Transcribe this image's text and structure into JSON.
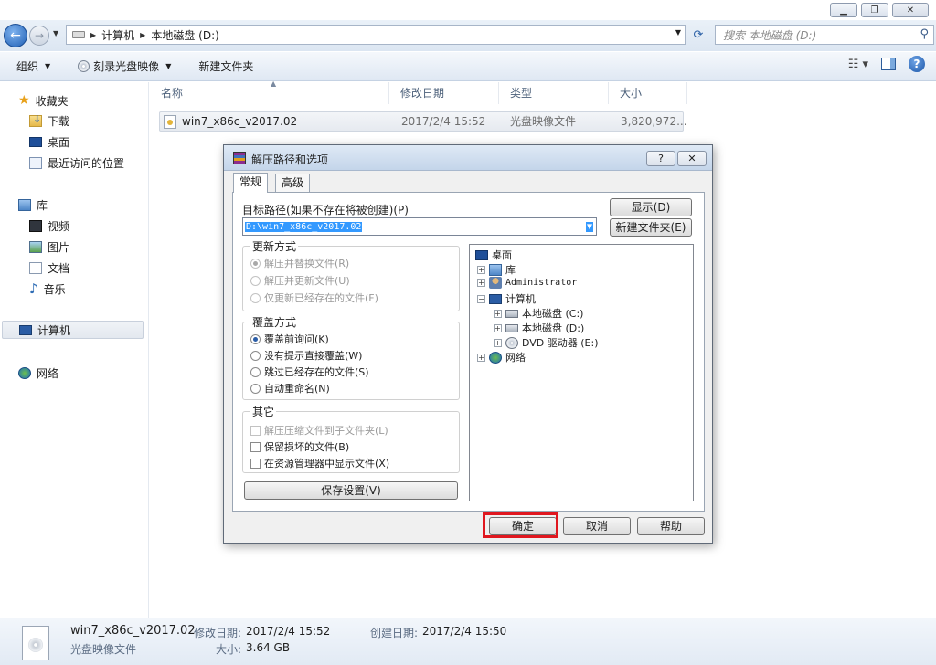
{
  "window": {
    "minimize_glyph": "▁",
    "maximize_glyph": "❐",
    "close_glyph": "✕"
  },
  "address": {
    "back_glyph": "←",
    "forward_glyph": "→",
    "crumbs": [
      "计算机",
      "本地磁盘 (D:)"
    ],
    "search_placeholder": "搜索 本地磁盘 (D:)"
  },
  "toolbar": {
    "organize": "组织",
    "burn": "刻录光盘映像",
    "new_folder": "新建文件夹"
  },
  "sidebar": {
    "favorites": "收藏夹",
    "downloads": "下载",
    "desktop": "桌面",
    "recent": "最近访问的位置",
    "libraries": "库",
    "videos": "视频",
    "pictures": "图片",
    "documents": "文档",
    "music": "音乐",
    "computer": "计算机",
    "network": "网络"
  },
  "file_list": {
    "columns": [
      "名称",
      "修改日期",
      "类型",
      "大小"
    ],
    "rows": [
      {
        "name": "win7_x86c_v2017.02",
        "modified": "2017/2/4 15:52",
        "type": "光盘映像文件",
        "size": "3,820,972..."
      }
    ]
  },
  "details": {
    "name": "win7_x86c_v2017.02",
    "type": "光盘映像文件",
    "modified_label": "修改日期:",
    "modified_value": "2017/2/4 15:52",
    "created_label": "创建日期:",
    "created_value": "2017/2/4 15:50",
    "size_label": "大小:",
    "size_value": "3.64 GB"
  },
  "dialog": {
    "title": "解压路径和选项",
    "help_glyph": "?",
    "close_glyph": "✕",
    "tabs": [
      "常规",
      "高级"
    ],
    "target_label": "目标路径(如果不存在将被创建)(P)",
    "target_value": "D:\\win7_x86c_v2017.02",
    "show_button": "显示(D)",
    "new_folder_button": "新建文件夹(E)",
    "update_group": {
      "title": "更新方式",
      "options": [
        "解压并替换文件(R)",
        "解压并更新文件(U)",
        "仅更新已经存在的文件(F)"
      ]
    },
    "overwrite_group": {
      "title": "覆盖方式",
      "options": [
        "覆盖前询问(K)",
        "没有提示直接覆盖(W)",
        "跳过已经存在的文件(S)",
        "自动重命名(N)"
      ]
    },
    "misc_group": {
      "title": "其它",
      "options": [
        "解压压缩文件到子文件夹(L)",
        "保留损坏的文件(B)",
        "在资源管理器中显示文件(X)"
      ]
    },
    "save_settings": "保存设置(V)",
    "tree": {
      "desktop": "桌面",
      "library": "库",
      "admin": "Administrator",
      "computer": "计算机",
      "disk_c": "本地磁盘 (C:)",
      "disk_d": "本地磁盘 (D:)",
      "dvd": "DVD 驱动器 (E:)",
      "network": "网络"
    },
    "ok": "确定",
    "cancel": "取消",
    "help": "帮助"
  }
}
